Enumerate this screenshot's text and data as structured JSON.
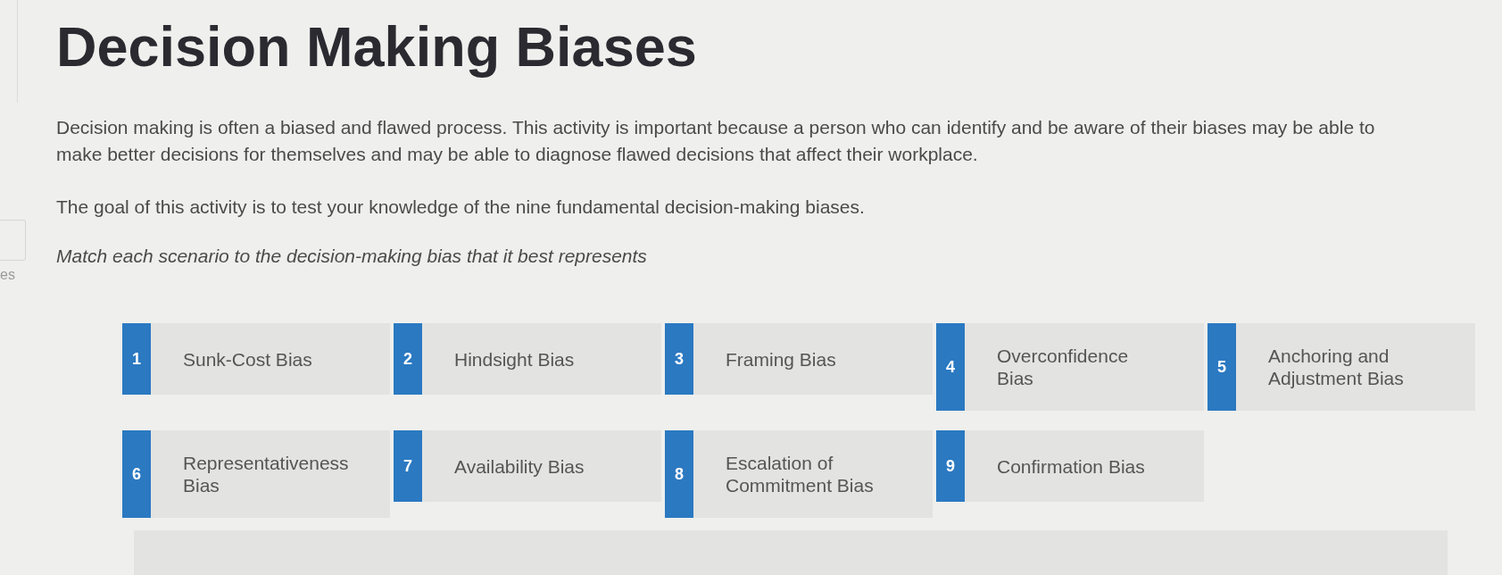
{
  "sidebar": {
    "cut_label": "es"
  },
  "title": "Decision Making Biases",
  "paragraphs": [
    "Decision making is often a biased and flawed process. This activity is important because a person who can identify and be aware of their biases may be able to make better decisions for themselves and may be able to diagnose flawed decisions that affect their workplace.",
    "The goal of this activity is to test your knowledge of the nine fundamental decision-making biases."
  ],
  "instruction": "Match each scenario to the decision-making bias that it best represents",
  "biases": [
    {
      "number": "1",
      "label": "Sunk-Cost Bias"
    },
    {
      "number": "2",
      "label": "Hindsight Bias"
    },
    {
      "number": "3",
      "label": "Framing Bias"
    },
    {
      "number": "4",
      "label": "Overconfidence Bias"
    },
    {
      "number": "5",
      "label": "Anchoring and Adjustment Bias"
    },
    {
      "number": "6",
      "label": "Representativeness Bias"
    },
    {
      "number": "7",
      "label": "Availability Bias"
    },
    {
      "number": "8",
      "label": "Escalation of Commitment Bias"
    },
    {
      "number": "9",
      "label": "Confirmation Bias"
    }
  ]
}
